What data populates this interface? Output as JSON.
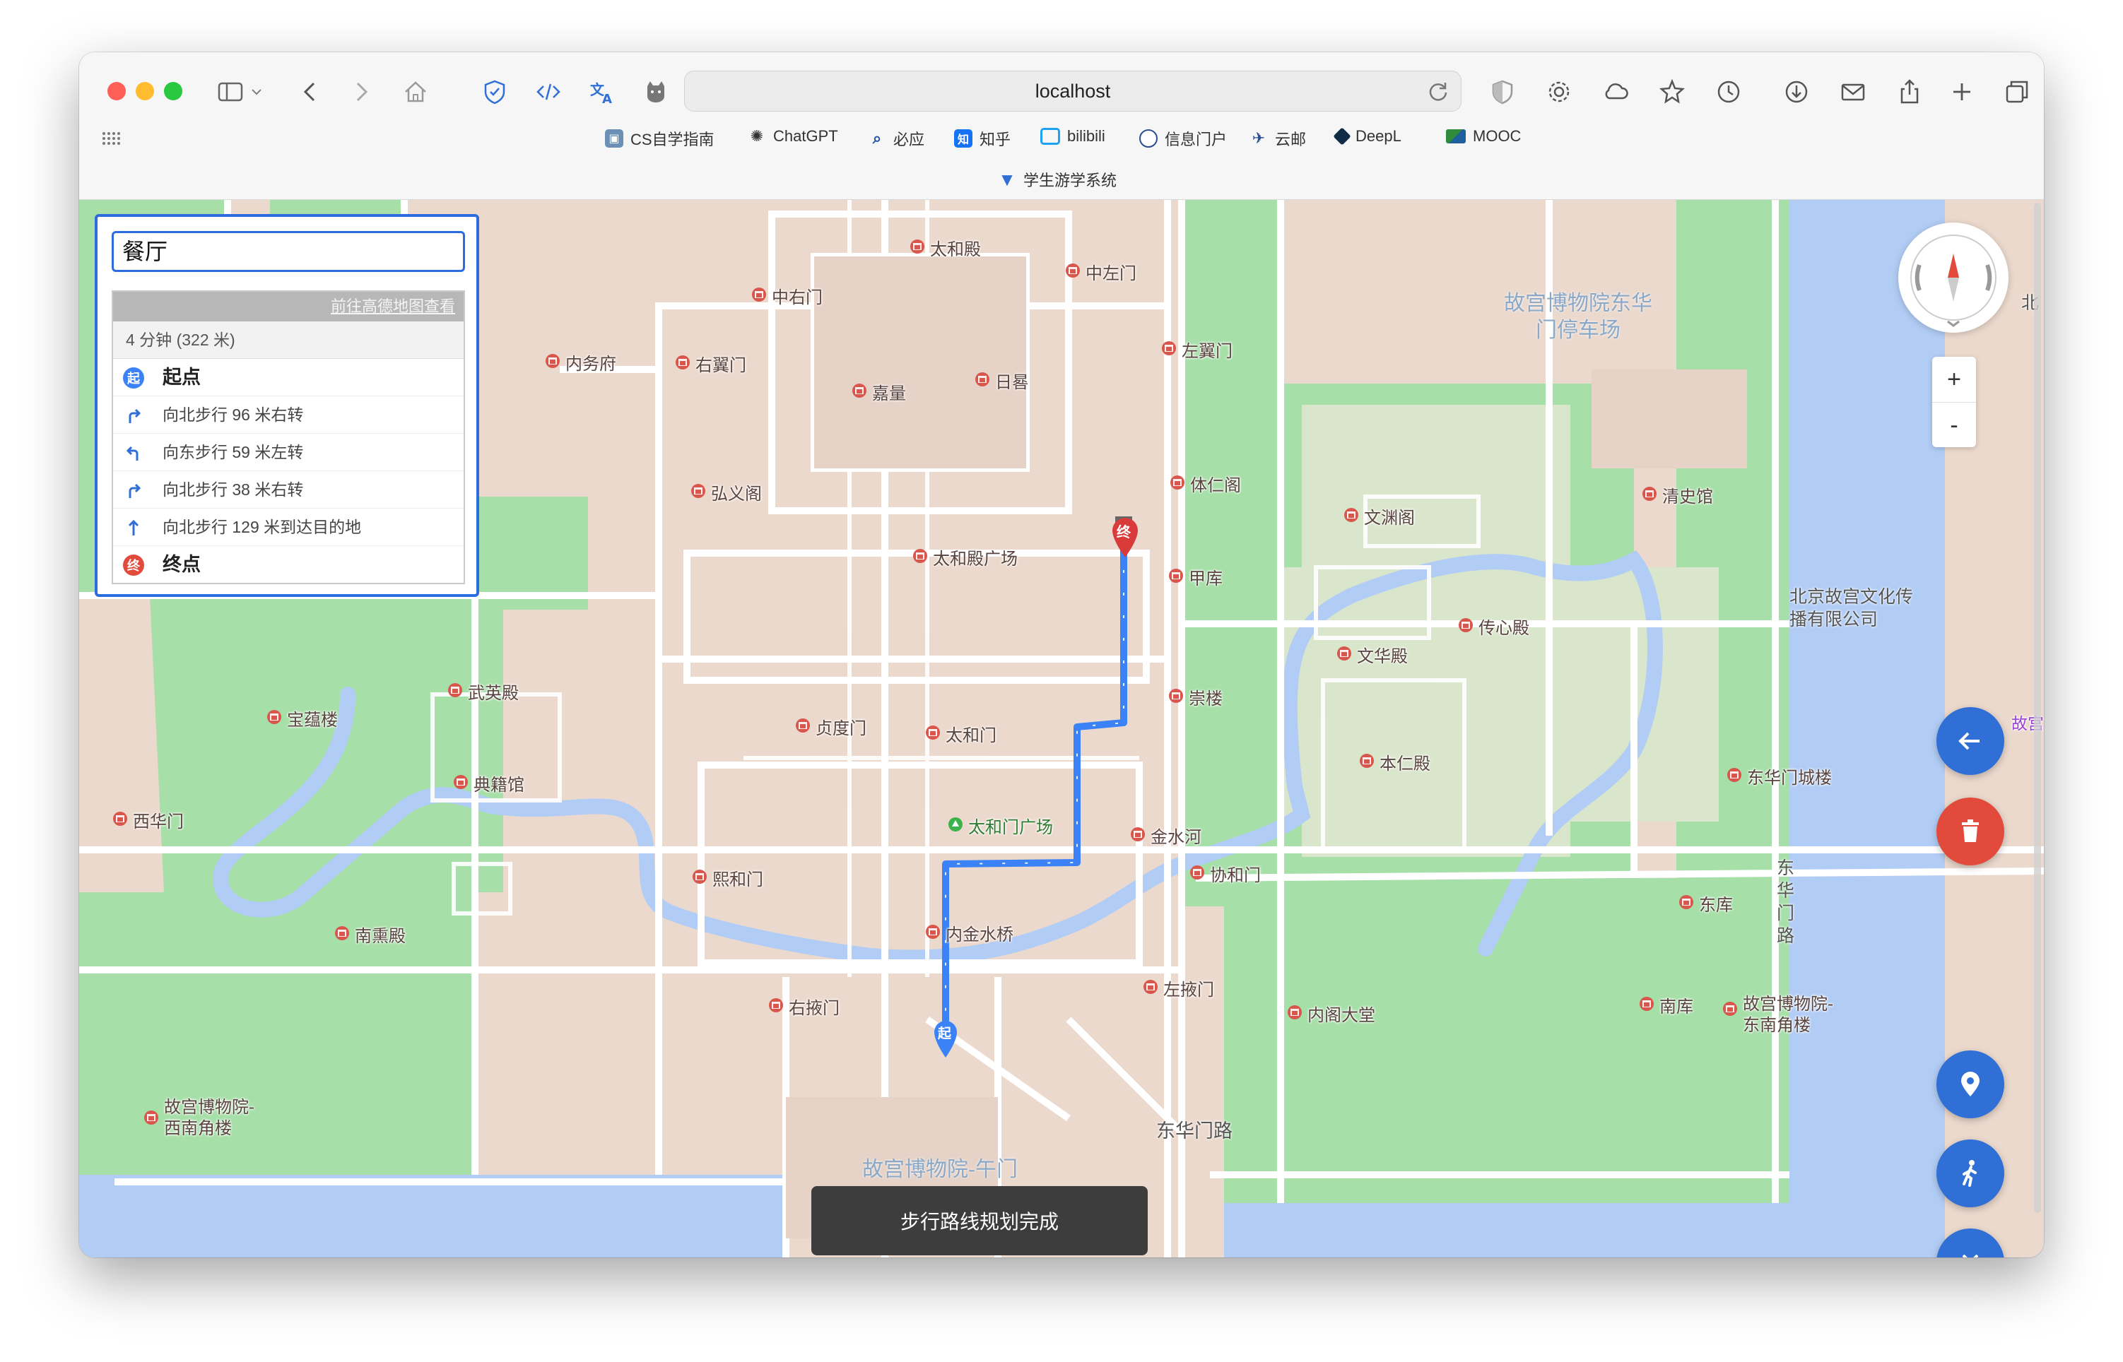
{
  "browser": {
    "url": "localhost",
    "bookmarks": [
      {
        "label": "CS自学指南",
        "icon": "cube-icon"
      },
      {
        "label": "ChatGPT",
        "icon": "openai-icon"
      },
      {
        "label": "必应",
        "icon": "bing-search-icon"
      },
      {
        "label": "知乎",
        "icon": "zhihu-icon"
      },
      {
        "label": "bilibili",
        "icon": "bilibili-tv-icon"
      },
      {
        "label": "信息门户",
        "icon": "portal-icon"
      },
      {
        "label": "云邮",
        "icon": "mail-plane-icon"
      },
      {
        "label": "DeepL",
        "icon": "deepl-icon"
      },
      {
        "label": "MOOC",
        "icon": "mooc-icon"
      },
      {
        "label": "学生游学系统",
        "icon": "v-logo-icon"
      }
    ]
  },
  "search": {
    "value": "餐厅"
  },
  "route": {
    "link_label": "前往高德地图查看",
    "summary": "4 分钟 (322 米)",
    "steps": [
      {
        "label": "起点",
        "icon": "start-badge-icon",
        "badge": "起"
      },
      {
        "label": "向北步行 96 米右转",
        "icon": "turn-right-icon"
      },
      {
        "label": "向东步行 59 米左转",
        "icon": "turn-left-icon"
      },
      {
        "label": "向北步行 38 米右转",
        "icon": "turn-right-icon"
      },
      {
        "label": "向北步行 129 米到达目的地",
        "icon": "straight-up-icon"
      },
      {
        "label": "终点",
        "icon": "end-badge-icon",
        "badge": "终"
      }
    ]
  },
  "map": {
    "pois": [
      {
        "label": "太和殿"
      },
      {
        "label": "中左门"
      },
      {
        "label": "中右门"
      },
      {
        "label": "左翼门"
      },
      {
        "label": "内务府"
      },
      {
        "label": "右翼门"
      },
      {
        "label": "嘉量"
      },
      {
        "label": "日晷"
      },
      {
        "label": "体仁阁"
      },
      {
        "label": "弘义阁"
      },
      {
        "label": "清史馆"
      },
      {
        "label": "文渊阁"
      },
      {
        "label": "太和殿广场"
      },
      {
        "label": "甲库"
      },
      {
        "label": "传心殿"
      },
      {
        "label": "文华殿"
      },
      {
        "label": "武英殿"
      },
      {
        "label": "崇楼"
      },
      {
        "label": "宝蕴楼"
      },
      {
        "label": "贞度门"
      },
      {
        "label": "太和门"
      },
      {
        "label": "本仁殿"
      },
      {
        "label": "典籍馆"
      },
      {
        "label": "东华门城楼"
      },
      {
        "label": "西华门"
      },
      {
        "label": "太和门广场"
      },
      {
        "label": "金水河"
      },
      {
        "label": "熙和门"
      },
      {
        "label": "协和门"
      },
      {
        "label": "东库"
      },
      {
        "label": "南熏殿"
      },
      {
        "label": "内金水桥"
      },
      {
        "label": "左掖门"
      },
      {
        "label": "右掖门"
      },
      {
        "label": "内阁大堂"
      },
      {
        "label": "南库"
      },
      {
        "label": "故宫博物院-东南角楼"
      },
      {
        "label": "故宫博物院-西南角楼"
      }
    ],
    "area_labels": {
      "parking": "故宫博物院东华门停车场",
      "culture": "北京故宫文化传播有限公司",
      "shop": "故宫商店",
      "road_donghua": "东华门路",
      "road_vertical": "东华门路",
      "wumen": "故宫博物院-午门",
      "side_letter": "北"
    },
    "markers": {
      "start": "起",
      "end": "终"
    },
    "route_color": "#3b82f6"
  },
  "controls": {
    "zoom_in": "+",
    "zoom_out": "-",
    "fab_colors": {
      "blue": "#2f6fd6",
      "red": "#e24b3b"
    }
  },
  "toast": {
    "message": "步行路线规划完成"
  }
}
